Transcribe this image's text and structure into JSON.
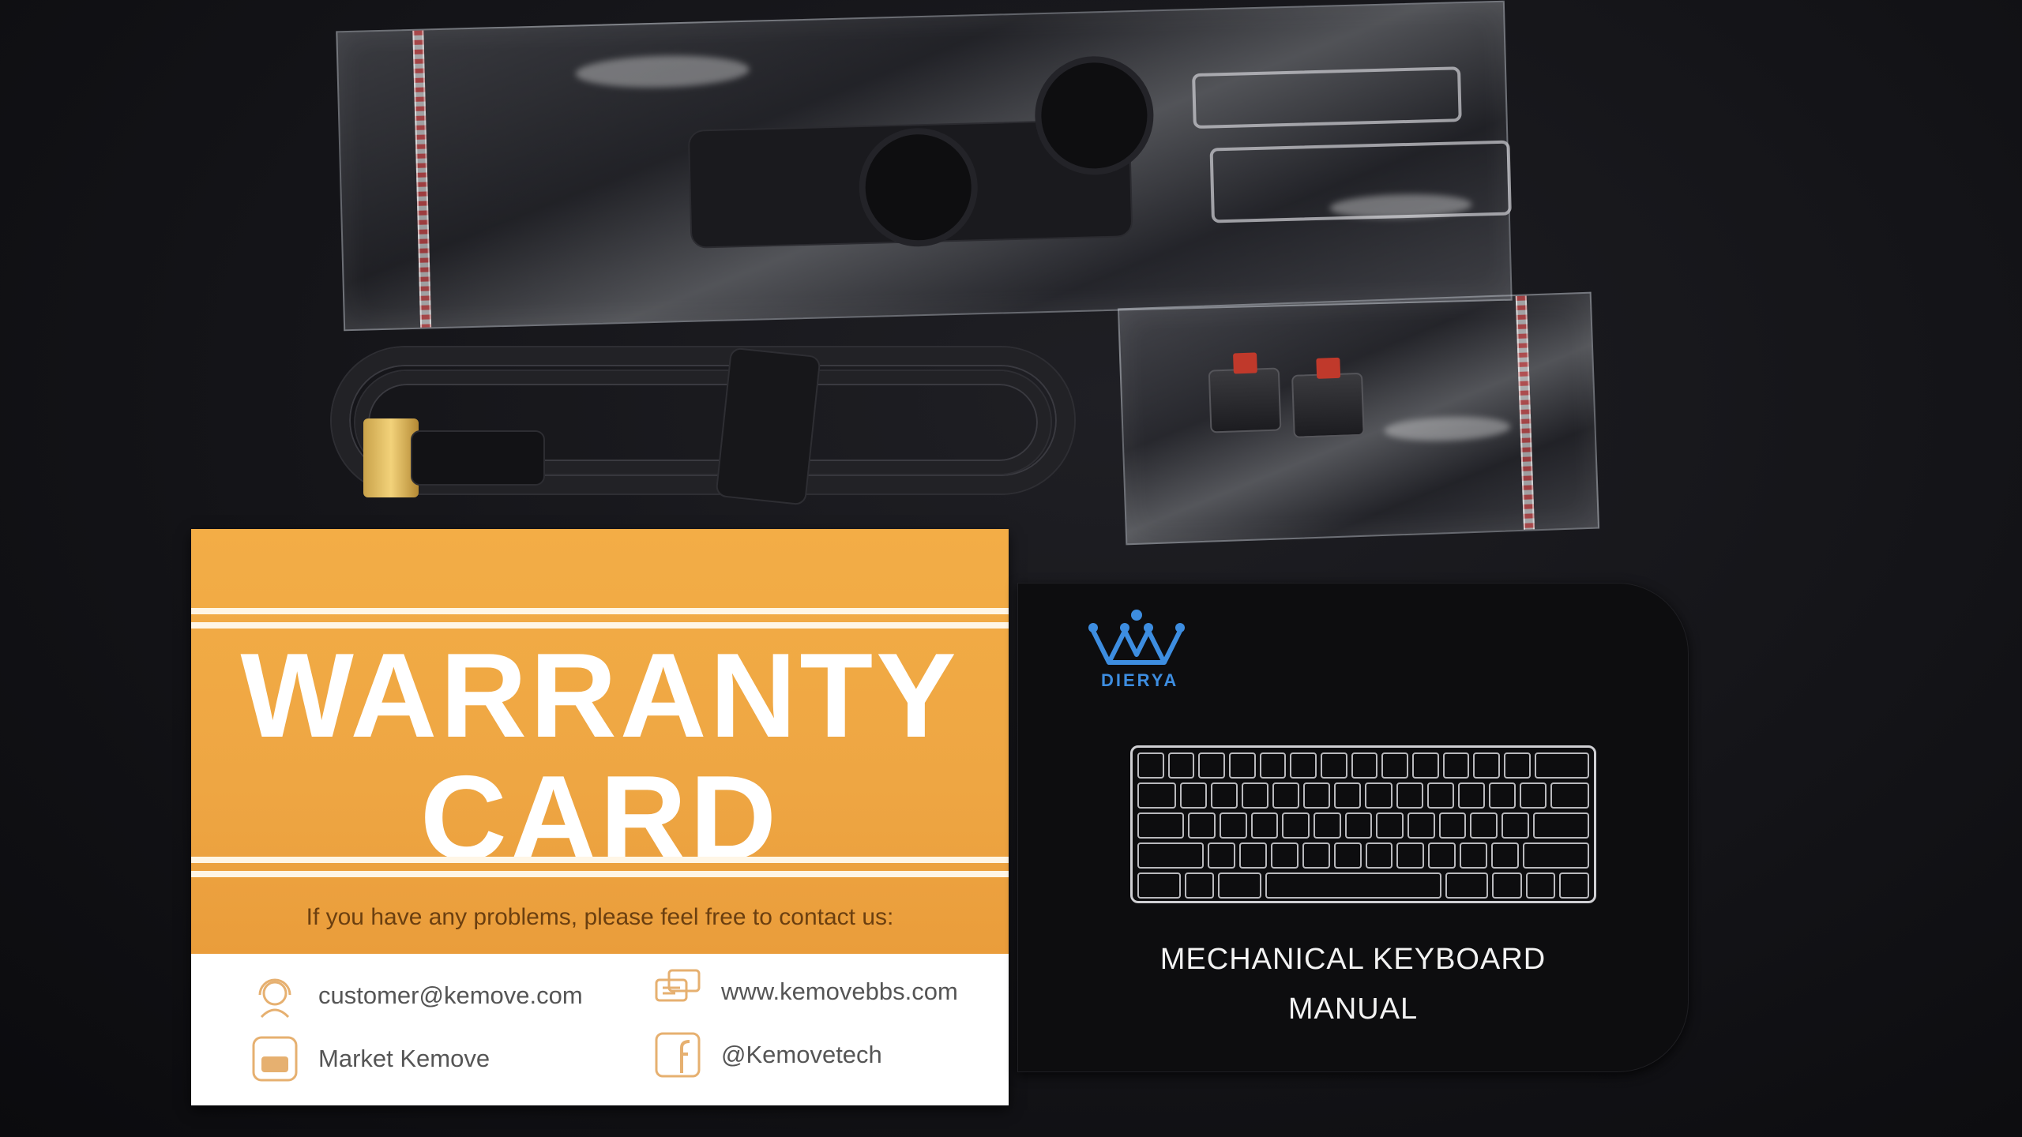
{
  "warranty_card": {
    "title_line1": "WARRANTY",
    "title_line2": "CARD",
    "contact_intro": "If you have any problems, please feel free to contact us:",
    "email": "customer@kemove.com",
    "website": "www.kemovebbs.com",
    "youtube": "Market Kemove",
    "facebook": "@Kemovetech",
    "accent_color": "#f0a846"
  },
  "manual": {
    "brand": "DIERYA",
    "title_line1": "MECHANICAL KEYBOARD",
    "title_line2": "MANUAL",
    "brand_color": "#3d8de0"
  }
}
